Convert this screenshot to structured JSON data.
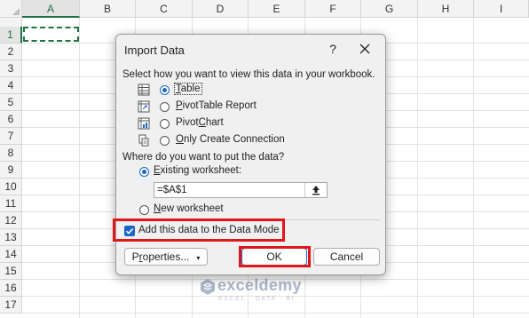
{
  "sheet": {
    "columns": [
      "A",
      "B",
      "C",
      "D",
      "E",
      "F",
      "G",
      "H",
      "I"
    ],
    "rows": [
      "1",
      "2",
      "3",
      "4",
      "5",
      "6",
      "7",
      "8",
      "9",
      "10",
      "11",
      "12",
      "13",
      "14",
      "15",
      "16",
      "17"
    ],
    "selected_column": "A",
    "selected_row": "1"
  },
  "dialog": {
    "title": "Import Data",
    "help": "?",
    "view_prompt": "Select how you want to view this data in your workbook.",
    "view_options": [
      {
        "label": "Table",
        "key": "T",
        "rest": "able",
        "selected": true,
        "icon": "table-icon"
      },
      {
        "label": "PivotTable Report",
        "key": "P",
        "rest": "ivotTable Report",
        "selected": false,
        "icon": "pivottable-icon"
      },
      {
        "label": "PivotChart",
        "pre": "Pivot",
        "key": "C",
        "rest": "hart",
        "selected": false,
        "icon": "pivotchart-icon"
      },
      {
        "label": "Only Create Connection",
        "key": "O",
        "rest": "nly Create Connection",
        "selected": false,
        "icon": "connection-icon"
      }
    ],
    "location_prompt": "Where do you want to put the data?",
    "existing_label_key": "E",
    "existing_label_rest": "xisting worksheet:",
    "existing_selected": true,
    "reference": "=$A$1",
    "new_label_key": "N",
    "new_label_rest": "ew worksheet",
    "data_model_label": "Add this data to the Data Mode",
    "data_model_checked": true,
    "properties_label_key": "r",
    "properties_label_pre": "P",
    "properties_label_rest": "operties...",
    "ok_label": "OK",
    "cancel_label": "Cancel"
  },
  "watermark": {
    "name": "exceldemy",
    "tagline": "EXCEL · DATA · BI"
  },
  "colors": {
    "accent": "#1a67c6",
    "highlight": "#e0161b",
    "excel_green": "#217346"
  }
}
